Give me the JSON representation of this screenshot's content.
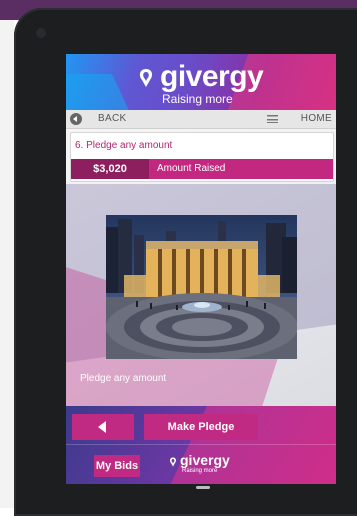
{
  "header": {
    "logo_text": "givergy",
    "tagline": "Raising more"
  },
  "nav": {
    "back_label": "BACK",
    "home_label": "HOME"
  },
  "item": {
    "title": "6. Pledge any amount",
    "amount": "$3,020",
    "amount_label": "Amount Raised"
  },
  "content": {
    "description": "Pledge any amount"
  },
  "actions": {
    "pledge_label": "Make Pledge",
    "bids_label": "My Bids"
  },
  "footer": {
    "logo_text": "givergy",
    "tagline": "Raising more"
  },
  "colors": {
    "brand_magenta": "#c12a82",
    "brand_dark": "#8e1f5e",
    "title_text": "#b02673"
  },
  "icons": [
    "camera-icon",
    "back-circle-icon",
    "menu-icon",
    "heart-logo-icon",
    "triangle-left-icon"
  ]
}
